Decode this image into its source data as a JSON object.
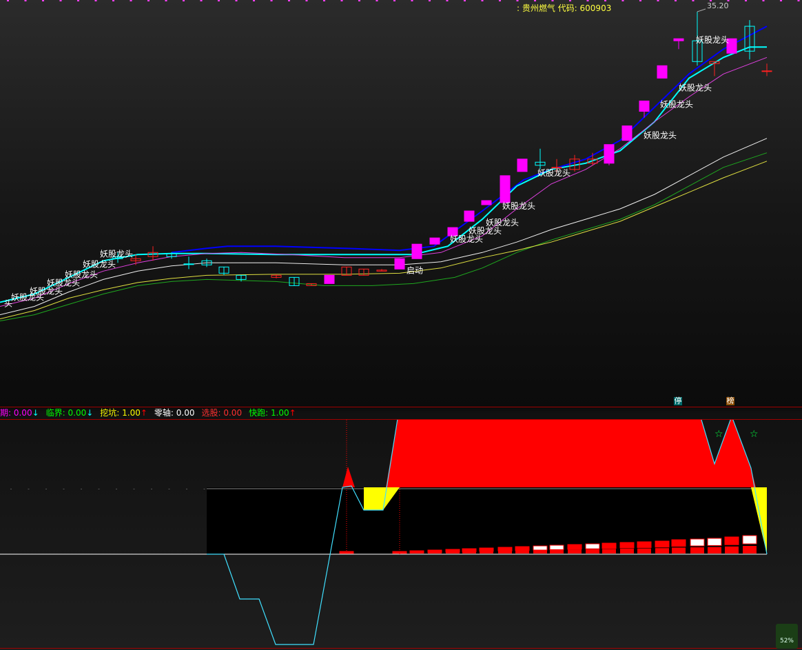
{
  "header": {
    "stock_label": ": 贵州燃气 代码: 600903",
    "price_high": "35.20"
  },
  "indicator_bar": {
    "items": [
      {
        "label": "期: ",
        "value": "0.00",
        "arrow": "↓",
        "label_color": "#ff00ff",
        "arrow_color": "#00ffff"
      },
      {
        "label": "临界: ",
        "value": "0.00",
        "arrow": "↓",
        "label_color": "#00ff00",
        "arrow_color": "#00ffff"
      },
      {
        "label": "挖坑: ",
        "value": "1.00",
        "arrow": "↑",
        "label_color": "#ffff00",
        "arrow_color": "#ff0000"
      },
      {
        "label": "零轴: ",
        "value": "0.00",
        "arrow": "",
        "label_color": "#ffffff",
        "arrow_color": "#ffffff"
      },
      {
        "label": "选股: ",
        "value": "0.00",
        "arrow": "",
        "label_color": "#ff3030",
        "arrow_color": "#ffffff"
      },
      {
        "label": "快跑: ",
        "value": "1.00",
        "arrow": "↑",
        "label_color": "#00ff00",
        "arrow_color": "#ff0000"
      }
    ]
  },
  "badges": {
    "stop": "停",
    "rank": "榜"
  },
  "battery": {
    "percent": "52%"
  },
  "colors": {
    "up": "#ff00ff",
    "down": "#00ffff",
    "red": "#ff0000",
    "ma_blue": "#0000ff",
    "ma_cyan": "#00ffff"
  },
  "chart_data": {
    "type": "candlestick",
    "price_ylim": [
      16.5,
      35.5
    ],
    "candles": [
      {
        "x": 171,
        "o": 23.3,
        "c": 23.4,
        "h": 23.6,
        "l": 23.1,
        "color": "cyan"
      },
      {
        "x": 197,
        "o": 23.2,
        "c": 23.3,
        "h": 23.5,
        "l": 23.0,
        "color": "red"
      },
      {
        "x": 222,
        "o": 23.4,
        "c": 23.6,
        "h": 23.9,
        "l": 23.2,
        "color": "red"
      },
      {
        "x": 249,
        "o": 23.4,
        "c": 23.55,
        "h": 23.6,
        "l": 23.3,
        "color": "cyan"
      },
      {
        "x": 274,
        "o": 23.05,
        "c": 23.05,
        "h": 23.4,
        "l": 22.8,
        "color": "cyan"
      },
      {
        "x": 300,
        "o": 23.0,
        "c": 23.2,
        "h": 23.3,
        "l": 22.9,
        "color": "cyan"
      },
      {
        "x": 325,
        "o": 22.6,
        "c": 22.9,
        "h": 22.9,
        "l": 22.5,
        "color": "cyan"
      },
      {
        "x": 350,
        "o": 22.3,
        "c": 22.5,
        "h": 22.5,
        "l": 22.2,
        "color": "cyan"
      },
      {
        "x": 401,
        "o": 22.4,
        "c": 22.5,
        "h": 22.55,
        "l": 22.35,
        "color": "red"
      },
      {
        "x": 427,
        "o": 22.0,
        "c": 22.4,
        "h": 22.4,
        "l": 22.0,
        "color": "cyan"
      },
      {
        "x": 452,
        "o": 22.0,
        "c": 22.1,
        "h": 22.1,
        "l": 22.0,
        "color": "red"
      },
      {
        "x": 478,
        "o": 22.1,
        "c": 22.5,
        "h": 22.5,
        "l": 22.1,
        "color": "magenta"
      },
      {
        "x": 503,
        "o": 22.5,
        "c": 22.9,
        "h": 22.9,
        "l": 22.5,
        "color": "red"
      },
      {
        "x": 528,
        "o": 22.5,
        "c": 22.8,
        "h": 22.8,
        "l": 22.5,
        "color": "red"
      },
      {
        "x": 554,
        "o": 22.7,
        "c": 22.75,
        "h": 22.8,
        "l": 22.7,
        "color": "red"
      },
      {
        "x": 580,
        "o": 22.8,
        "c": 23.3,
        "h": 23.3,
        "l": 22.8,
        "color": "magenta"
      },
      {
        "x": 605,
        "o": 23.3,
        "c": 24.0,
        "h": 24.0,
        "l": 23.3,
        "color": "magenta"
      },
      {
        "x": 631,
        "o": 24.0,
        "c": 24.3,
        "h": 24.3,
        "l": 24.0,
        "color": "magenta"
      },
      {
        "x": 657,
        "o": 24.4,
        "c": 24.8,
        "h": 24.8,
        "l": 24.4,
        "color": "magenta"
      },
      {
        "x": 681,
        "o": 25.1,
        "c": 25.6,
        "h": 25.6,
        "l": 25.1,
        "color": "magenta"
      },
      {
        "x": 706,
        "o": 25.9,
        "c": 26.1,
        "h": 26.1,
        "l": 25.9,
        "color": "magenta"
      },
      {
        "x": 733,
        "o": 26.0,
        "c": 27.3,
        "h": 27.3,
        "l": 26.0,
        "color": "magenta"
      },
      {
        "x": 758,
        "o": 27.5,
        "c": 28.1,
        "h": 28.1,
        "l": 27.5,
        "color": "magenta"
      },
      {
        "x": 784,
        "o": 27.8,
        "c": 27.95,
        "h": 28.6,
        "l": 27.6,
        "color": "cyan"
      },
      {
        "x": 808,
        "o": 27.7,
        "c": 27.7,
        "h": 28.1,
        "l": 27.4,
        "color": "red"
      },
      {
        "x": 834,
        "o": 27.6,
        "c": 28.1,
        "h": 28.3,
        "l": 27.5,
        "color": "red"
      },
      {
        "x": 860,
        "o": 27.9,
        "c": 28.1,
        "h": 28.4,
        "l": 27.8,
        "color": "red"
      },
      {
        "x": 884,
        "o": 27.9,
        "c": 28.8,
        "h": 28.8,
        "l": 27.8,
        "color": "magenta"
      },
      {
        "x": 910,
        "o": 29.0,
        "c": 29.7,
        "h": 29.7,
        "l": 29.0,
        "color": "magenta"
      },
      {
        "x": 935,
        "o": 30.4,
        "c": 30.9,
        "h": 30.9,
        "l": 30.1,
        "color": "magenta"
      },
      {
        "x": 961,
        "o": 32.0,
        "c": 32.6,
        "h": 32.6,
        "l": 32.0,
        "color": "magenta"
      },
      {
        "x": 985,
        "o": 33.8,
        "c": 33.9,
        "h": 33.9,
        "l": 33.4,
        "color": "magenta"
      },
      {
        "x": 1012,
        "o": 33.8,
        "c": 32.8,
        "h": 35.2,
        "l": 32.6,
        "color": "cyan"
      },
      {
        "x": 1037,
        "o": 32.7,
        "c": 32.8,
        "h": 32.8,
        "l": 32.1,
        "color": "red"
      },
      {
        "x": 1062,
        "o": 33.2,
        "c": 33.9,
        "h": 33.9,
        "l": 33.2,
        "color": "magenta"
      },
      {
        "x": 1088,
        "o": 34.5,
        "c": 33.3,
        "h": 34.8,
        "l": 32.9,
        "color": "cyan"
      },
      {
        "x": 1113,
        "o": 32.35,
        "c": 32.35,
        "h": 32.7,
        "l": 32.1,
        "color": "red"
      }
    ],
    "series": [
      {
        "name": "blue",
        "color": "#0000ff",
        "width": 2,
        "points": [
          [
            249,
            23.6
          ],
          [
            300,
            23.8
          ],
          [
            330,
            23.9
          ],
          [
            400,
            23.9
          ],
          [
            500,
            23.8
          ],
          [
            580,
            23.7
          ],
          [
            630,
            23.9
          ],
          [
            700,
            25.6
          ],
          [
            760,
            27.1
          ],
          [
            800,
            27.6
          ],
          [
            850,
            28.1
          ],
          [
            900,
            29.0
          ],
          [
            950,
            30.6
          ],
          [
            1000,
            32.2
          ],
          [
            1050,
            33.4
          ],
          [
            1113,
            34.5
          ]
        ]
      },
      {
        "name": "cyan",
        "color": "#00ffff",
        "width": 2,
        "points": [
          [
            0,
            21.2
          ],
          [
            50,
            21.6
          ],
          [
            100,
            22.4
          ],
          [
            150,
            23.2
          ],
          [
            200,
            23.5
          ],
          [
            249,
            23.55
          ],
          [
            300,
            23.55
          ],
          [
            400,
            23.5
          ],
          [
            500,
            23.5
          ],
          [
            600,
            23.5
          ],
          [
            650,
            23.9
          ],
          [
            700,
            25.2
          ],
          [
            750,
            26.8
          ],
          [
            800,
            27.6
          ],
          [
            850,
            27.9
          ],
          [
            900,
            28.5
          ],
          [
            950,
            29.9
          ],
          [
            1000,
            32.0
          ],
          [
            1050,
            33.0
          ],
          [
            1088,
            33.5
          ],
          [
            1113,
            33.5
          ]
        ]
      },
      {
        "name": "magenta",
        "color": "#e040e0",
        "width": 1,
        "points": [
          [
            0,
            21.0
          ],
          [
            50,
            21.4
          ],
          [
            100,
            22.1
          ],
          [
            150,
            22.7
          ],
          [
            200,
            23.1
          ],
          [
            249,
            23.4
          ],
          [
            300,
            23.55
          ],
          [
            350,
            23.6
          ],
          [
            420,
            23.5
          ],
          [
            500,
            23.35
          ],
          [
            580,
            23.35
          ],
          [
            640,
            23.6
          ],
          [
            700,
            24.4
          ],
          [
            750,
            25.7
          ],
          [
            800,
            26.9
          ],
          [
            850,
            27.6
          ],
          [
            900,
            28.6
          ],
          [
            950,
            29.9
          ],
          [
            1000,
            31.1
          ],
          [
            1050,
            32.2
          ],
          [
            1113,
            33.0
          ]
        ]
      },
      {
        "name": "white",
        "color": "#f0f0f0",
        "width": 1,
        "points": [
          [
            0,
            20.6
          ],
          [
            50,
            21.0
          ],
          [
            100,
            21.7
          ],
          [
            150,
            22.3
          ],
          [
            200,
            22.7
          ],
          [
            249,
            22.95
          ],
          [
            300,
            23.1
          ],
          [
            400,
            23.1
          ],
          [
            500,
            23.0
          ],
          [
            580,
            23.0
          ],
          [
            640,
            23.15
          ],
          [
            700,
            23.6
          ],
          [
            750,
            24.1
          ],
          [
            800,
            24.7
          ],
          [
            850,
            25.2
          ],
          [
            900,
            25.7
          ],
          [
            950,
            26.4
          ],
          [
            1000,
            27.3
          ],
          [
            1050,
            28.2
          ],
          [
            1113,
            29.1
          ]
        ]
      },
      {
        "name": "green",
        "color": "#1fa81f",
        "width": 1,
        "points": [
          [
            0,
            20.3
          ],
          [
            50,
            20.6
          ],
          [
            100,
            21.1
          ],
          [
            150,
            21.6
          ],
          [
            200,
            22.0
          ],
          [
            249,
            22.2
          ],
          [
            300,
            22.3
          ],
          [
            400,
            22.2
          ],
          [
            470,
            22.0
          ],
          [
            540,
            22.0
          ],
          [
            600,
            22.1
          ],
          [
            660,
            22.4
          ],
          [
            700,
            22.85
          ],
          [
            750,
            23.6
          ],
          [
            800,
            24.2
          ],
          [
            850,
            24.7
          ],
          [
            900,
            25.2
          ],
          [
            950,
            25.9
          ],
          [
            1000,
            26.8
          ],
          [
            1050,
            27.7
          ],
          [
            1113,
            28.4
          ]
        ]
      },
      {
        "name": "yellow",
        "color": "#e0e040",
        "width": 1,
        "points": [
          [
            0,
            20.4
          ],
          [
            50,
            20.8
          ],
          [
            100,
            21.4
          ],
          [
            150,
            21.8
          ],
          [
            200,
            22.15
          ],
          [
            249,
            22.35
          ],
          [
            300,
            22.5
          ],
          [
            400,
            22.55
          ],
          [
            500,
            22.55
          ],
          [
            580,
            22.6
          ],
          [
            640,
            22.85
          ],
          [
            700,
            23.35
          ],
          [
            750,
            23.7
          ],
          [
            800,
            24.1
          ],
          [
            850,
            24.6
          ],
          [
            900,
            25.1
          ],
          [
            950,
            25.8
          ],
          [
            1000,
            26.5
          ],
          [
            1050,
            27.2
          ],
          [
            1113,
            28.0
          ]
        ]
      }
    ],
    "annotations": [
      {
        "x": 145,
        "y": 23.4,
        "text": "妖股龙头"
      },
      {
        "x": 120,
        "y": 22.9,
        "text": "妖股龙头"
      },
      {
        "x": 94,
        "y": 22.4,
        "text": "妖股龙头"
      },
      {
        "x": 68,
        "y": 22.0,
        "text": "妖股龙头"
      },
      {
        "x": 43,
        "y": 21.6,
        "text": "妖股龙头"
      },
      {
        "x": 16,
        "y": 21.3,
        "text": "妖股龙头"
      },
      {
        "x": 6,
        "y": 21.0,
        "text": "头"
      },
      {
        "x": 653,
        "y": 24.1,
        "text": "妖股龙头"
      },
      {
        "x": 680,
        "y": 24.5,
        "text": "妖股龙头"
      },
      {
        "x": 705,
        "y": 24.9,
        "text": "妖股龙头"
      },
      {
        "x": 729,
        "y": 25.7,
        "text": "妖股龙头"
      },
      {
        "x": 780,
        "y": 27.3,
        "text": "妖股龙头"
      },
      {
        "x": 934,
        "y": 29.1,
        "text": "妖股龙头"
      },
      {
        "x": 958,
        "y": 30.6,
        "text": "妖股龙头"
      },
      {
        "x": 985,
        "y": 31.4,
        "text": "妖股龙头"
      },
      {
        "x": 1010,
        "y": 33.7,
        "text": "妖股龙头"
      },
      {
        "x": 590,
        "y": 22.6,
        "text": "启动"
      }
    ],
    "sub_chart": {
      "type": "area",
      "baseline_y": 100,
      "zero_line_y": 195,
      "cyan_line": [
        [
          300,
          195
        ],
        [
          325,
          195
        ],
        [
          348,
          260
        ],
        [
          376,
          260
        ],
        [
          400,
          326
        ],
        [
          455,
          326
        ],
        [
          497,
          98
        ],
        [
          510,
          96
        ],
        [
          528,
          131
        ],
        [
          556,
          131
        ],
        [
          580,
          -20
        ],
        [
          1015,
          -10
        ],
        [
          1037,
          64
        ],
        [
          1062,
          -5
        ],
        [
          1090,
          70
        ],
        [
          1113,
          195
        ]
      ],
      "red_fill": [
        [
          497,
          98
        ],
        [
          505,
          68
        ],
        [
          515,
          98
        ],
        [
          560,
          98
        ],
        [
          580,
          -20
        ],
        [
          1015,
          -10
        ],
        [
          1037,
          64
        ],
        [
          1062,
          -5
        ],
        [
          1090,
          70
        ],
        [
          1097,
          98
        ]
      ],
      "yellow_fill": [
        [
          [
            528,
            98
          ],
          [
            528,
            131
          ],
          [
            556,
            131
          ],
          [
            580,
            98
          ]
        ],
        [
          [
            1090,
            98
          ],
          [
            1113,
            98
          ],
          [
            1113,
            195
          ]
        ]
      ],
      "black_box": [
        300,
        98,
        1113,
        195
      ],
      "stars_x": [
        1043,
        1094
      ],
      "bars": [
        {
          "x": 503,
          "h": 2,
          "w": 20,
          "hollow": false
        },
        {
          "x": 580,
          "h": 2,
          "w": 20,
          "hollow": false
        },
        {
          "x": 605,
          "h": 3,
          "w": 20,
          "hollow": false
        },
        {
          "x": 631,
          "h": 4,
          "w": 20,
          "hollow": false
        },
        {
          "x": 657,
          "h": 5,
          "w": 20,
          "hollow": false
        },
        {
          "x": 681,
          "h": 6,
          "w": 20,
          "hollow": false
        },
        {
          "x": 706,
          "h": 7,
          "w": 20,
          "hollow": false
        },
        {
          "x": 733,
          "h": 8,
          "w": 20,
          "hollow": false
        },
        {
          "x": 758,
          "h": 9,
          "w": 20,
          "hollow": false
        },
        {
          "x": 784,
          "h": 10,
          "w": 20,
          "hollow": true
        },
        {
          "x": 808,
          "h": 11,
          "w": 20,
          "hollow": true
        },
        {
          "x": 834,
          "h": 12,
          "w": 20,
          "hollow": false
        },
        {
          "x": 860,
          "h": 13,
          "w": 20,
          "hollow": true
        },
        {
          "x": 884,
          "h": 14,
          "w": 20,
          "hollow": false
        },
        {
          "x": 910,
          "h": 15,
          "w": 20,
          "hollow": false
        },
        {
          "x": 935,
          "h": 16,
          "w": 20,
          "hollow": false
        },
        {
          "x": 961,
          "h": 17,
          "w": 20,
          "hollow": false
        },
        {
          "x": 985,
          "h": 19,
          "w": 20,
          "hollow": false
        },
        {
          "x": 1012,
          "h": 20,
          "w": 20,
          "hollow": true
        },
        {
          "x": 1037,
          "h": 21,
          "w": 20,
          "hollow": true
        },
        {
          "x": 1062,
          "h": 23,
          "w": 20,
          "hollow": false
        },
        {
          "x": 1088,
          "h": 25,
          "w": 20,
          "hollow": true
        }
      ]
    }
  }
}
